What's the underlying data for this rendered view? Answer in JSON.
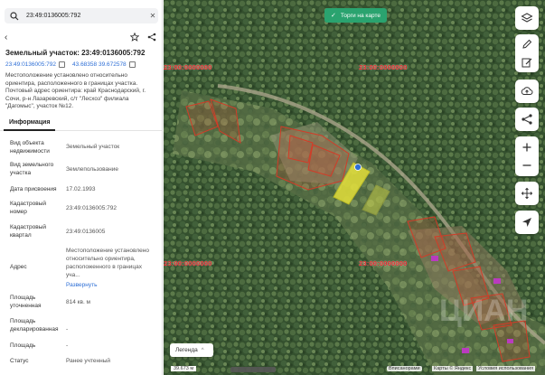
{
  "search": {
    "value": "23:49:0136005:792",
    "icon": "search-icon",
    "clear_icon": "close-icon"
  },
  "nav": {
    "back_icon": "chevron-left-icon",
    "bookmark_icon": "star-icon",
    "share_icon": "share-icon"
  },
  "parcel": {
    "title": "Земельный участок: 23:49:0136005:792",
    "cad_number": "23:49:0136005:792",
    "coords": "43.68358 39.672578",
    "description": "Местоположение установлено относительно ориентира, расположенного в границах участка. Почтовый адрес ориентира: край Краснодарский, г. Сочи, р-н Лазаревский, с/т \"Лесхоз\" филиала \"Дагомыс\", участок №12."
  },
  "tabs": [
    {
      "label": "Информация",
      "active": true
    }
  ],
  "info_rows": [
    {
      "key": "Вид объекта недвижимости",
      "value": "Земельный участок"
    },
    {
      "key": "Вид земельного участка",
      "value": "Землепользование"
    },
    {
      "key": "Дата присвоения",
      "value": "17.02.1993"
    },
    {
      "key": "Кадастровый номер",
      "value": "23:49:0136005:792"
    },
    {
      "key": "Кадастровый квартал",
      "value": "23:49:0136005"
    },
    {
      "key": "Адрес",
      "value": "Местоположение установлено относительно ориентира, расположенного в границах уча...",
      "link": "Развернуть"
    },
    {
      "key": "Площадь уточненная",
      "value": "814 кв. м"
    },
    {
      "key": "Площадь декларированная",
      "value": "-"
    },
    {
      "key": "Площадь",
      "value": "-"
    },
    {
      "key": "Статус",
      "value": "Ранее учтенный"
    }
  ],
  "map": {
    "cad_labels": [
      "23:00:0000000",
      "23:00:0000000",
      "23:00:0000000",
      "23:00:0000000"
    ],
    "badge": "Торги на карте",
    "legend": "Легенда",
    "scale": "39.673 м",
    "panorama": "Вписанорами",
    "copyright1": "Карты © Яндекс",
    "copyright2": "Условия использования",
    "watermark": "ЦИАН",
    "toolbar": [
      "layers-icon",
      "pencil-icon",
      "edit-icon",
      "cloud-upload-icon",
      "share-nodes-icon",
      "zoom-in-icon",
      "zoom-out-icon",
      "move-icon",
      "locate-icon"
    ]
  },
  "colors": {
    "accent": "#2e6fd6",
    "badge": "#2aa36f",
    "cad_red": "#e02525",
    "parcel_yellow": "#e4e03a"
  }
}
